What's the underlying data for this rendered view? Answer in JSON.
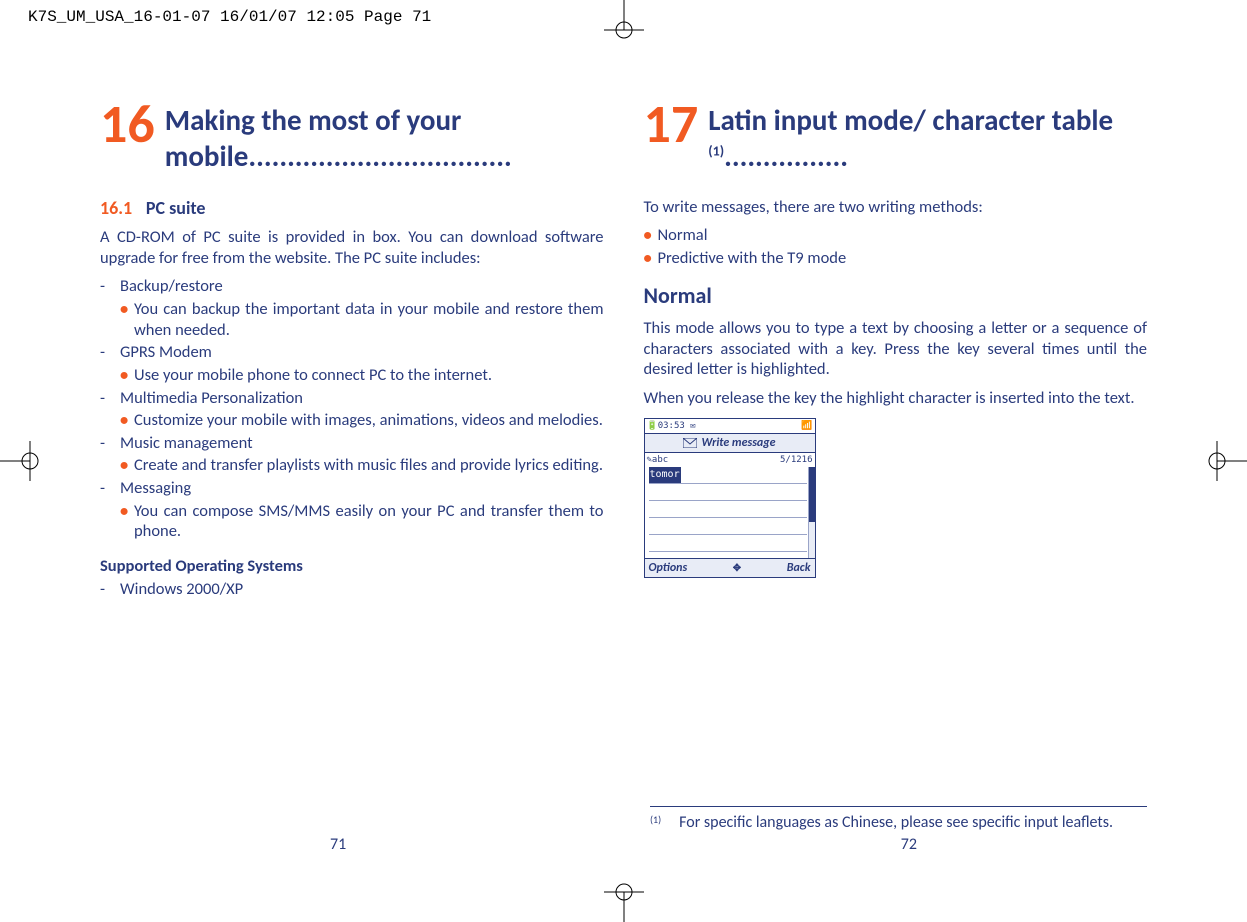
{
  "header_line": "K7S_UM_USA_16-01-07  16/01/07  12:05  Page 71",
  "left": {
    "chapter_num": "16",
    "chapter_title": "Making the most of your mobile..................................",
    "section_num": "16.1",
    "section_title": "PC suite",
    "intro": "A CD-ROM of PC suite is provided in box. You can download software upgrade for free from the website. The PC suite includes:",
    "items": [
      {
        "head": "Backup/restore",
        "sub": "You can backup the important data in your mobile and restore them when needed."
      },
      {
        "head": "GPRS Modem",
        "sub": "Use your mobile phone to connect PC to the internet."
      },
      {
        "head": "Multimedia Personalization",
        "sub": "Customize your mobile with images, animations, videos and melodies."
      },
      {
        "head": "Music management",
        "sub": "Create and transfer playlists with music files and provide lyrics editing."
      },
      {
        "head": "Messaging",
        "sub": "You can compose SMS/MMS easily on your PC and transfer them to phone."
      }
    ],
    "supported_head": "Supported Operating Systems",
    "supported_item": "Windows 2000/XP",
    "page_num": "71"
  },
  "right": {
    "chapter_num": "17",
    "chapter_title_main": "Latin input mode/ character table ",
    "chapter_title_sup": "(1)",
    "chapter_title_dots": "................",
    "intro": "To write messages, there are two writing methods:",
    "methods": [
      "Normal",
      "Predictive with the T9 mode"
    ],
    "subhead": "Normal",
    "p1": "This mode allows you to type a text by choosing a letter or a sequence of characters associated with a key. Press the key several times until the desired letter is highlighted.",
    "p2": "When you release the key the highlight character is inserted into the text.",
    "phone": {
      "time": "03:53",
      "signal_icon": "signal-icon",
      "title": "Write message",
      "info_left": "abc",
      "info_right": "5/1216",
      "typed": "tomor",
      "softkey_left": "Options",
      "softkey_right": "Back"
    },
    "footnote_mark": "(1)",
    "footnote_text": "For specific languages as Chinese, please see specific input leaflets.",
    "page_num": "72"
  }
}
